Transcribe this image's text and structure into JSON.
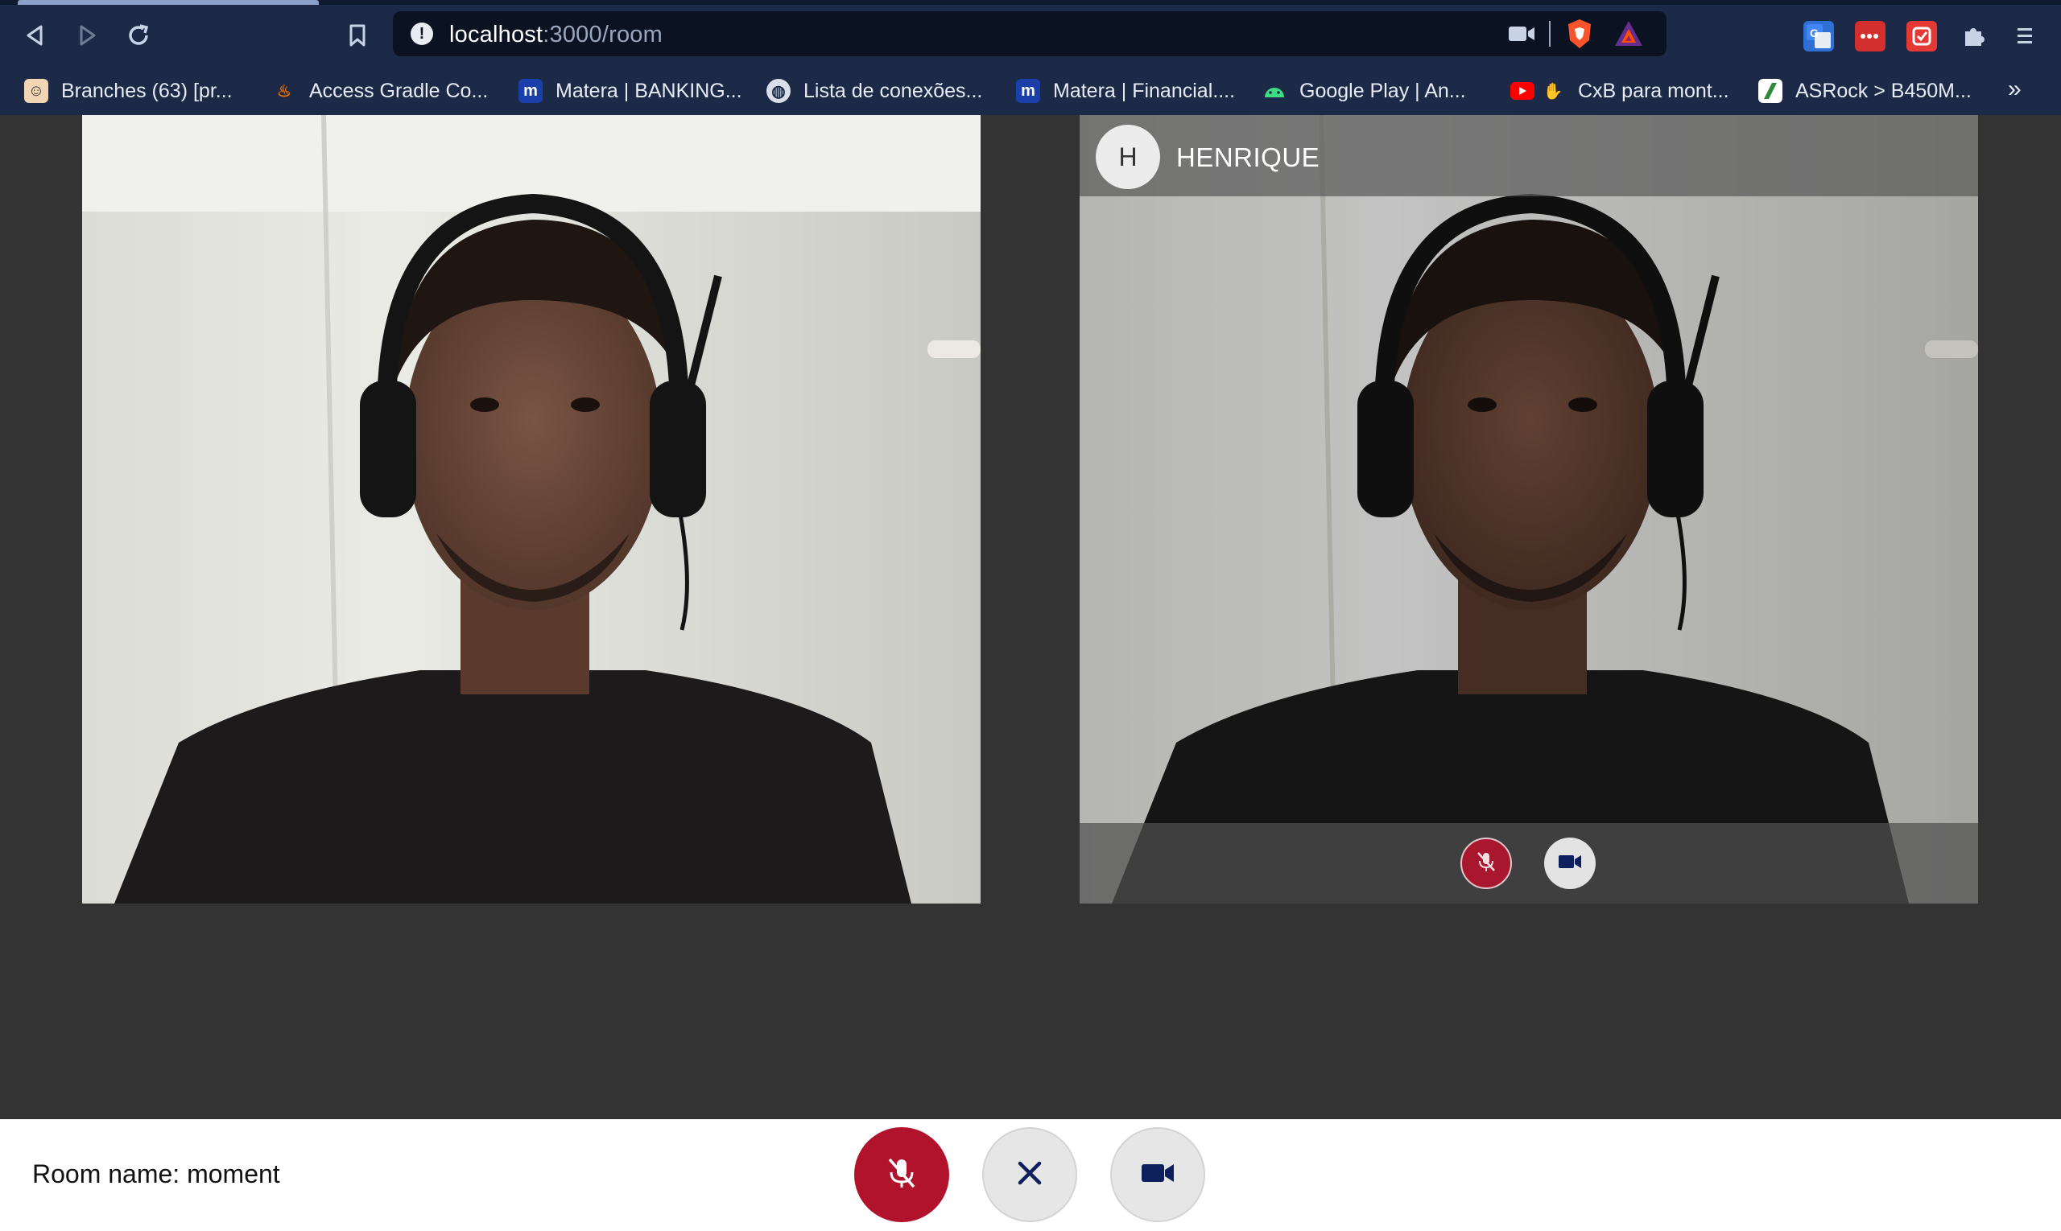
{
  "browser": {
    "url_host": "localhost",
    "url_rest": ":3000/room",
    "icons": {
      "back": "back-arrow-icon",
      "forward": "forward-arrow-icon",
      "reload": "reload-icon",
      "bookmark": "bookmark-icon",
      "site_info": "site-info-icon",
      "camera": "camera-icon",
      "brave": "brave-shield-icon",
      "rewards": "brave-rewards-icon",
      "extensions": "puzzle-piece-icon",
      "menu": "hamburger-menu-icon"
    }
  },
  "bookmarks": [
    {
      "label": "Branches (63) [pr...",
      "icon": "jenkins-icon"
    },
    {
      "label": "Access Gradle Co...",
      "icon": "java-icon"
    },
    {
      "label": "Matera | BANKING...",
      "icon": "matera-icon"
    },
    {
      "label": "Lista de conexões...",
      "icon": "globe-icon"
    },
    {
      "label": "Matera | Financial....",
      "icon": "matera-icon"
    },
    {
      "label": "Google Play  |  An...",
      "icon": "android-icon"
    },
    {
      "label": "CxB para mont...",
      "icon": "youtube-handshake-icon"
    },
    {
      "label": "ASRock > B450M...",
      "icon": "asrock-icon"
    }
  ],
  "bookmarks_overflow": "»",
  "remote": {
    "avatar_initial": "H",
    "name": "HENRIQUE"
  },
  "footer": {
    "room_label": "Room name: moment"
  },
  "colors": {
    "chrome": "#1c2a47",
    "content_bg": "#333333",
    "mic_muted": "#b0132b",
    "control_bg": "#e6e6e6",
    "icon_navy": "#0d1f5c"
  }
}
